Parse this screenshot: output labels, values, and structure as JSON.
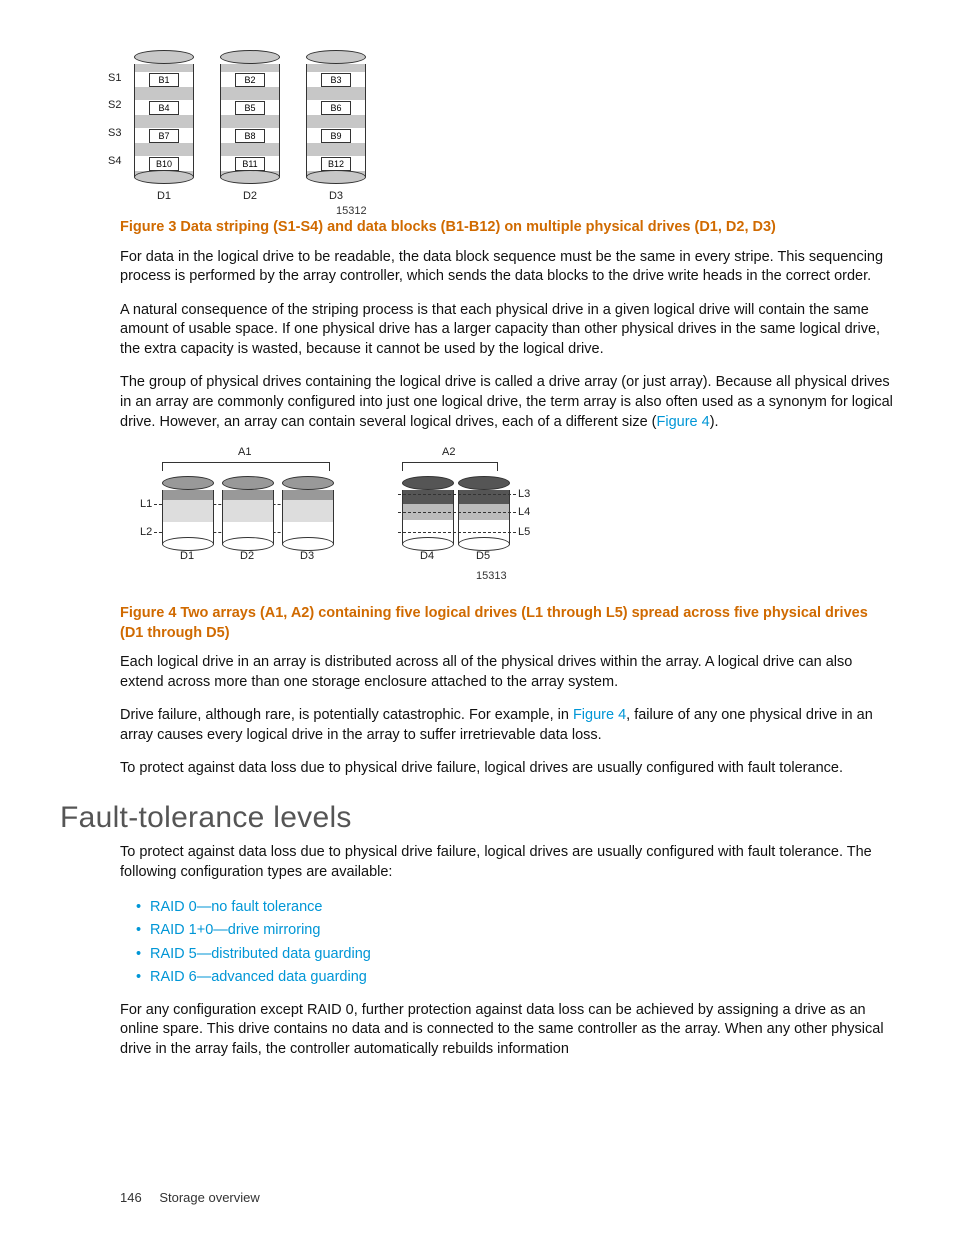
{
  "fig3": {
    "stripe_labels": [
      "S1",
      "S2",
      "S3",
      "S4"
    ],
    "drives": [
      {
        "label": "D1",
        "blocks": [
          "B1",
          "B4",
          "B7",
          "B10"
        ]
      },
      {
        "label": "D2",
        "blocks": [
          "B2",
          "B5",
          "B8",
          "B11"
        ]
      },
      {
        "label": "D3",
        "blocks": [
          "B3",
          "B6",
          "B9",
          "B12"
        ]
      }
    ],
    "ref": "15312",
    "caption": "Figure 3 Data striping (S1-S4) and data blocks (B1-B12) on multiple physical drives (D1, D2, D3)"
  },
  "para1": "For data in the logical drive to be readable, the data block sequence must be the same in every stripe. This sequencing process is performed by the array controller, which sends the data blocks to the drive write heads in the correct order.",
  "para2": "A natural consequence of the striping process is that each physical drive in a given logical drive will contain the same amount of usable space. If one physical drive has a larger capacity than other physical drives in the same logical drive, the extra capacity is wasted, because it cannot be used by the logical drive.",
  "para3_a": "The group of physical drives containing the logical drive is called a drive array (or just array). Because all physical drives in an array are commonly configured into just one logical drive, the term array is also often used as a synonym for logical drive. However, an array can contain several logical drives, each of a different size (",
  "para3_link": "Figure 4",
  "para3_b": ").",
  "fig4": {
    "arrays": [
      "A1",
      "A2"
    ],
    "l_labels": [
      "L1",
      "L2",
      "L3",
      "L4",
      "L5"
    ],
    "d_labels": [
      "D1",
      "D2",
      "D3",
      "D4",
      "D5"
    ],
    "ref": "15313",
    "caption": "Figure 4 Two arrays (A1, A2) containing five logical drives (L1 through L5) spread across five physical drives (D1 through D5)"
  },
  "para4": "Each logical drive in an array is distributed across all of the physical drives within the array. A logical drive can also extend across more than one storage enclosure attached to the array system.",
  "para5_a": "Drive failure, although rare, is potentially catastrophic. For example, in ",
  "para5_link": "Figure 4",
  "para5_b": ", failure of any one physical drive in an array causes every logical drive in the array to suffer irretrievable data loss.",
  "para6": "To protect against data loss due to physical drive failure, logical drives are usually configured with fault tolerance.",
  "section_heading": "Fault-tolerance levels",
  "para7": "To protect against data loss due to physical drive failure, logical drives are usually configured with fault tolerance. The following configuration types are available:",
  "raid_list": [
    "RAID 0—no fault tolerance",
    "RAID 1+0—drive mirroring",
    "RAID 5—distributed data guarding",
    "RAID 6—advanced data guarding"
  ],
  "para8": "For any configuration except RAID 0, further protection against data loss can be achieved by assigning a drive as an online spare. This drive contains no data and is connected to the same controller as the array. When any other physical drive in the array fails, the controller automatically rebuilds information",
  "footer": {
    "page": "146",
    "title": "Storage overview"
  }
}
